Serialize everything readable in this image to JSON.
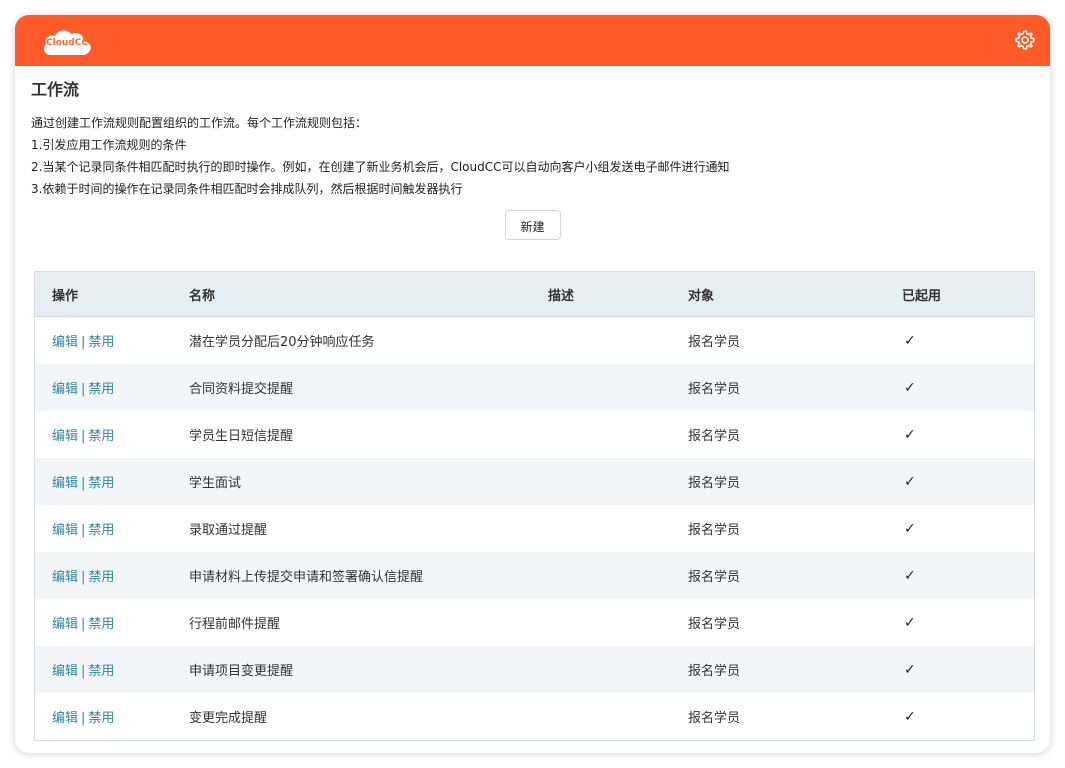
{
  "header": {
    "logo_text": "CloudCC",
    "brand_color": "#ff5a28",
    "settings_icon": "gear-icon"
  },
  "page": {
    "title": "工作流",
    "description": [
      "通过创建工作流规则配置组织的工作流。每个工作流规则包括：",
      "1.引发应用工作流规则的条件",
      "2.当某个记录同条件相匹配时执行的即时操作。例如，在创建了新业务机会后，CloudCC可以自动向客户小组发送电子邮件进行通知",
      "3.依赖于时间的操作在记录同条件相匹配时会排成队列，然后根据时间触发器执行"
    ],
    "new_button": "新建"
  },
  "table": {
    "columns": [
      "操作",
      "名称",
      "描述",
      "对象",
      "已起用"
    ],
    "action_edit": "编辑",
    "action_sep": "|",
    "action_disable": "禁用",
    "check_glyph": "✓",
    "rows": [
      {
        "name": "潜在学员分配后20分钟响应任务",
        "desc": "",
        "object": "报名学员",
        "enabled": true
      },
      {
        "name": "合同资料提交提醒",
        "desc": "",
        "object": "报名学员",
        "enabled": true
      },
      {
        "name": "学员生日短信提醒",
        "desc": "",
        "object": "报名学员",
        "enabled": true
      },
      {
        "name": "学生面试",
        "desc": "",
        "object": "报名学员",
        "enabled": true
      },
      {
        "name": "录取通过提醒",
        "desc": "",
        "object": "报名学员",
        "enabled": true
      },
      {
        "name": "申请材料上传提交申请和签署确认信提醒",
        "desc": "",
        "object": "报名学员",
        "enabled": true
      },
      {
        "name": "行程前邮件提醒",
        "desc": "",
        "object": "报名学员",
        "enabled": true
      },
      {
        "name": "申请项目变更提醒",
        "desc": "",
        "object": "报名学员",
        "enabled": true
      },
      {
        "name": "变更完成提醒",
        "desc": "",
        "object": "报名学员",
        "enabled": true
      }
    ]
  }
}
